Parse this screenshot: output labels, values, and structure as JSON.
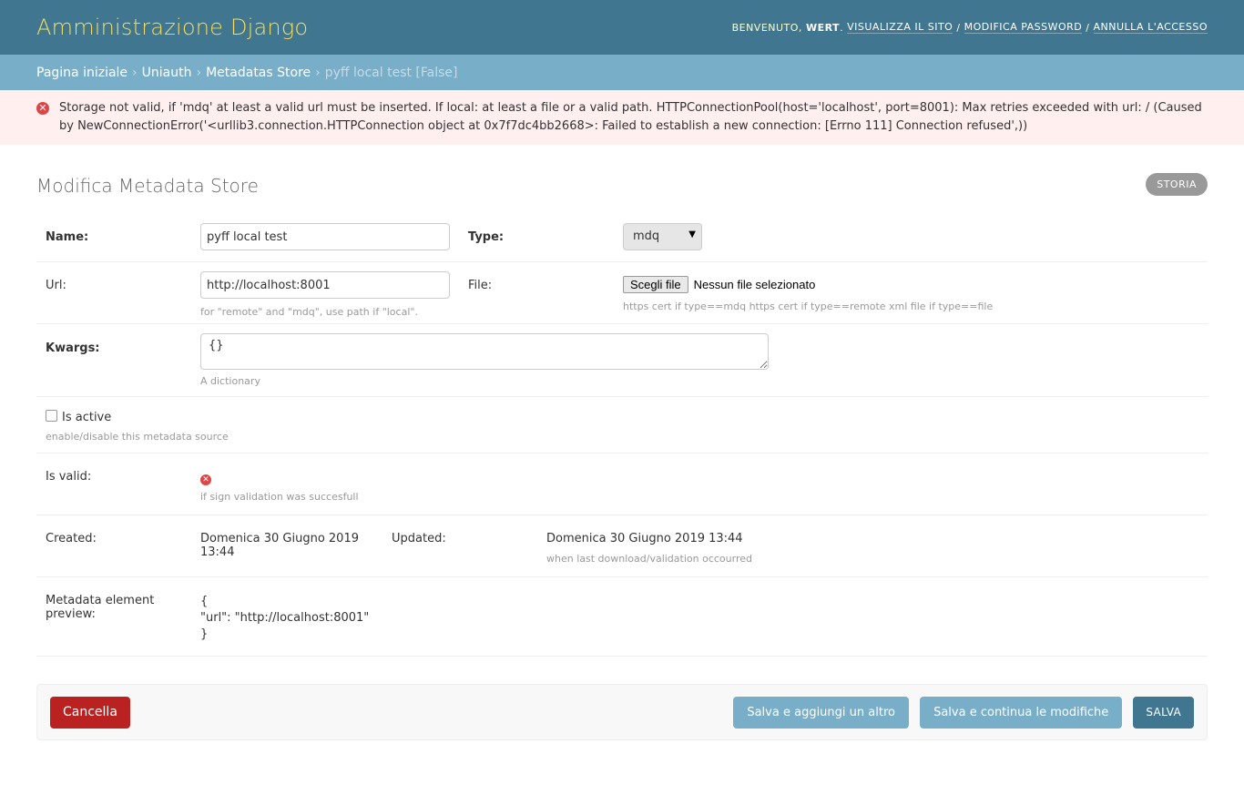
{
  "header": {
    "brand": "Amministrazione Django",
    "welcome": "Benvenuto,",
    "username": "wert",
    "view_site": "Visualizza il sito",
    "change_password": "Modifica password",
    "logout": "Annulla l'accesso",
    "separator": "/"
  },
  "breadcrumbs": {
    "items": [
      "Pagina iniziale",
      "Uniauth",
      "Metadatas Store"
    ],
    "current": "pyff local test [False]",
    "separator": "›"
  },
  "error": {
    "message": "Storage not valid, if 'mdq' at least a valid url must be inserted. If local: at least a file or a valid path. HTTPConnectionPool(host='localhost', port=8001): Max retries exceeded with url: / (Caused by NewConnectionError('<urllib3.connection.HTTPConnection object at 0x7f7dc4bb2668>: Failed to establish a new connection: [Errno 111] Connection refused',))"
  },
  "page": {
    "title": "Modifica Metadata Store",
    "history_button": "Storia"
  },
  "form": {
    "name": {
      "label": "Name:",
      "value": "pyff local test"
    },
    "type": {
      "label": "Type:",
      "value": "mdq"
    },
    "url": {
      "label": "Url:",
      "value": "http://localhost:8001",
      "help": "for \"remote\" and \"mdq\", use path if \"local\"."
    },
    "file": {
      "label": "File:",
      "button": "Scegli file",
      "status": "Nessun file selezionato",
      "help": "https cert if type==mdq https cert if type==remote xml file if type==file"
    },
    "kwargs": {
      "label": "Kwargs:",
      "value": "{}",
      "help": "A dictionary"
    },
    "is_active": {
      "label": "Is active",
      "checked": false,
      "help": "enable/disable this metadata source"
    },
    "is_valid": {
      "label": "Is valid:",
      "icon": "false-icon",
      "help": "if sign validation was succesfull"
    },
    "created": {
      "label": "Created:",
      "value": "Domenica 30 Giugno 2019 13:44"
    },
    "updated": {
      "label": "Updated:",
      "value": "Domenica 30 Giugno 2019 13:44",
      "help": "when last download/validation occourred"
    },
    "preview": {
      "label": "Metadata element preview:",
      "lines": [
        "{",
        "\"url\": \"http://localhost:8001\"",
        "}"
      ]
    }
  },
  "actions": {
    "delete": "Cancella",
    "save_add": "Salva e aggiungi un altro",
    "save_continue": "Salva e continua le modifiche",
    "save": "Salva"
  },
  "colors": {
    "header": "#417690",
    "brand": "#f5dd5d",
    "breadcrumbs": "#79aec8",
    "error_bg": "#ffefef",
    "delete": "#ba2121"
  }
}
